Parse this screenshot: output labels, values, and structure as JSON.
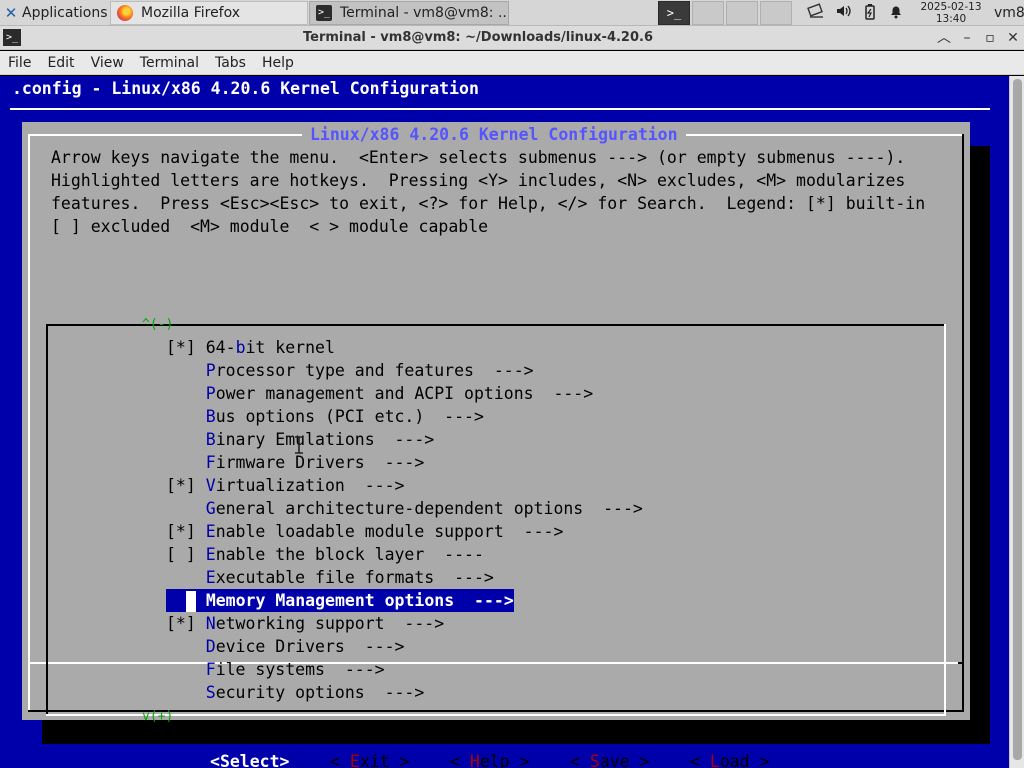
{
  "panel": {
    "applications": "Applications",
    "tasks": [
      {
        "label": "Mozilla Firefox",
        "icon": "firefox-icon"
      },
      {
        "label": "Terminal - vm8@vm8: ...",
        "icon": "terminal-icon"
      }
    ],
    "clock": {
      "date": "2025-02-13",
      "time": "13:40"
    },
    "user": "vm8",
    "tray_icons": [
      "network-icon",
      "volume-icon",
      "battery-icon",
      "notification-bell-icon"
    ]
  },
  "window": {
    "title": "Terminal - vm8@vm8: ~/Downloads/linux-4.20.6",
    "menu": [
      "File",
      "Edit",
      "View",
      "Terminal",
      "Tabs",
      "Help"
    ]
  },
  "terminal": {
    "header": ".config - Linux/x86 4.20.6 Kernel Configuration",
    "dialog_title": "Linux/x86 4.20.6 Kernel Configuration",
    "help_lines": [
      "Arrow keys navigate the menu.  <Enter> selects submenus ---> (or empty submenus ----).",
      "Highlighted letters are hotkeys.  Pressing <Y> includes, <N> excludes, <M> modularizes",
      "features.  Press <Esc><Esc> to exit, <?> for Help, </> for Search.  Legend: [*] built-in",
      "[ ] excluded  <M> module  < > module capable"
    ],
    "scroll_up": "^(-)",
    "scroll_down": "v(+)",
    "menu_items": [
      {
        "prefix": "[*] ",
        "pre": "64-",
        "hot": "b",
        "rest": "it kernel"
      },
      {
        "prefix": "    ",
        "pre": "",
        "hot": "P",
        "rest": "rocessor type and features  --->"
      },
      {
        "prefix": "    ",
        "pre": "",
        "hot": "P",
        "rest": "ower management and ACPI options  --->"
      },
      {
        "prefix": "    ",
        "pre": "",
        "hot": "B",
        "rest": "us options (PCI etc.)  --->"
      },
      {
        "prefix": "    ",
        "pre": "",
        "hot": "B",
        "rest": "inary Emulations  --->"
      },
      {
        "prefix": "    ",
        "pre": "",
        "hot": "F",
        "rest": "irmware Drivers  --->"
      },
      {
        "prefix": "[*] ",
        "pre": "",
        "hot": "V",
        "rest": "irtualization  --->"
      },
      {
        "prefix": "    ",
        "pre": "",
        "hot": "G",
        "rest": "eneral architecture-dependent options  --->"
      },
      {
        "prefix": "[*] ",
        "pre": "",
        "hot": "E",
        "rest": "nable loadable module support  --->"
      },
      {
        "prefix": "[ ] ",
        "pre": "",
        "hot": "E",
        "rest": "nable the block layer  ----"
      },
      {
        "prefix": "    ",
        "pre": "",
        "hot": "E",
        "rest": "xecutable file formats  --->"
      },
      {
        "prefix": "    ",
        "pre": "",
        "hot": "M",
        "rest": "emory Management options  --->",
        "selected": true
      },
      {
        "prefix": "[*] ",
        "pre": "",
        "hot": "N",
        "rest": "etworking support  --->"
      },
      {
        "prefix": "    ",
        "pre": "",
        "hot": "D",
        "rest": "evice Drivers  --->"
      },
      {
        "prefix": "    ",
        "pre": "",
        "hot": "F",
        "rest": "ile systems  --->"
      },
      {
        "prefix": "    ",
        "pre": "",
        "hot": "S",
        "rest": "ecurity options  --->"
      }
    ],
    "buttons": [
      {
        "open": "<",
        "hot": "S",
        "rest": "elect",
        "close": ">",
        "selected": true
      },
      {
        "open": "< ",
        "hot": "E",
        "rest": "xit",
        "close": " >"
      },
      {
        "open": "< ",
        "hot": "H",
        "rest": "elp",
        "close": " >"
      },
      {
        "open": "< ",
        "hot": "S",
        "rest": "ave",
        "close": " >"
      },
      {
        "open": "< ",
        "hot": "L",
        "rest": "oad",
        "close": " >"
      }
    ]
  },
  "colors": {
    "terminal_bg": "#0000aa",
    "dialog_bg": "#aaaaaa",
    "dialog_title": "#5555ff",
    "hotkey": "#0000aa",
    "button_hotkey": "#aa0000",
    "scroll_indicator": "#00aa00"
  }
}
